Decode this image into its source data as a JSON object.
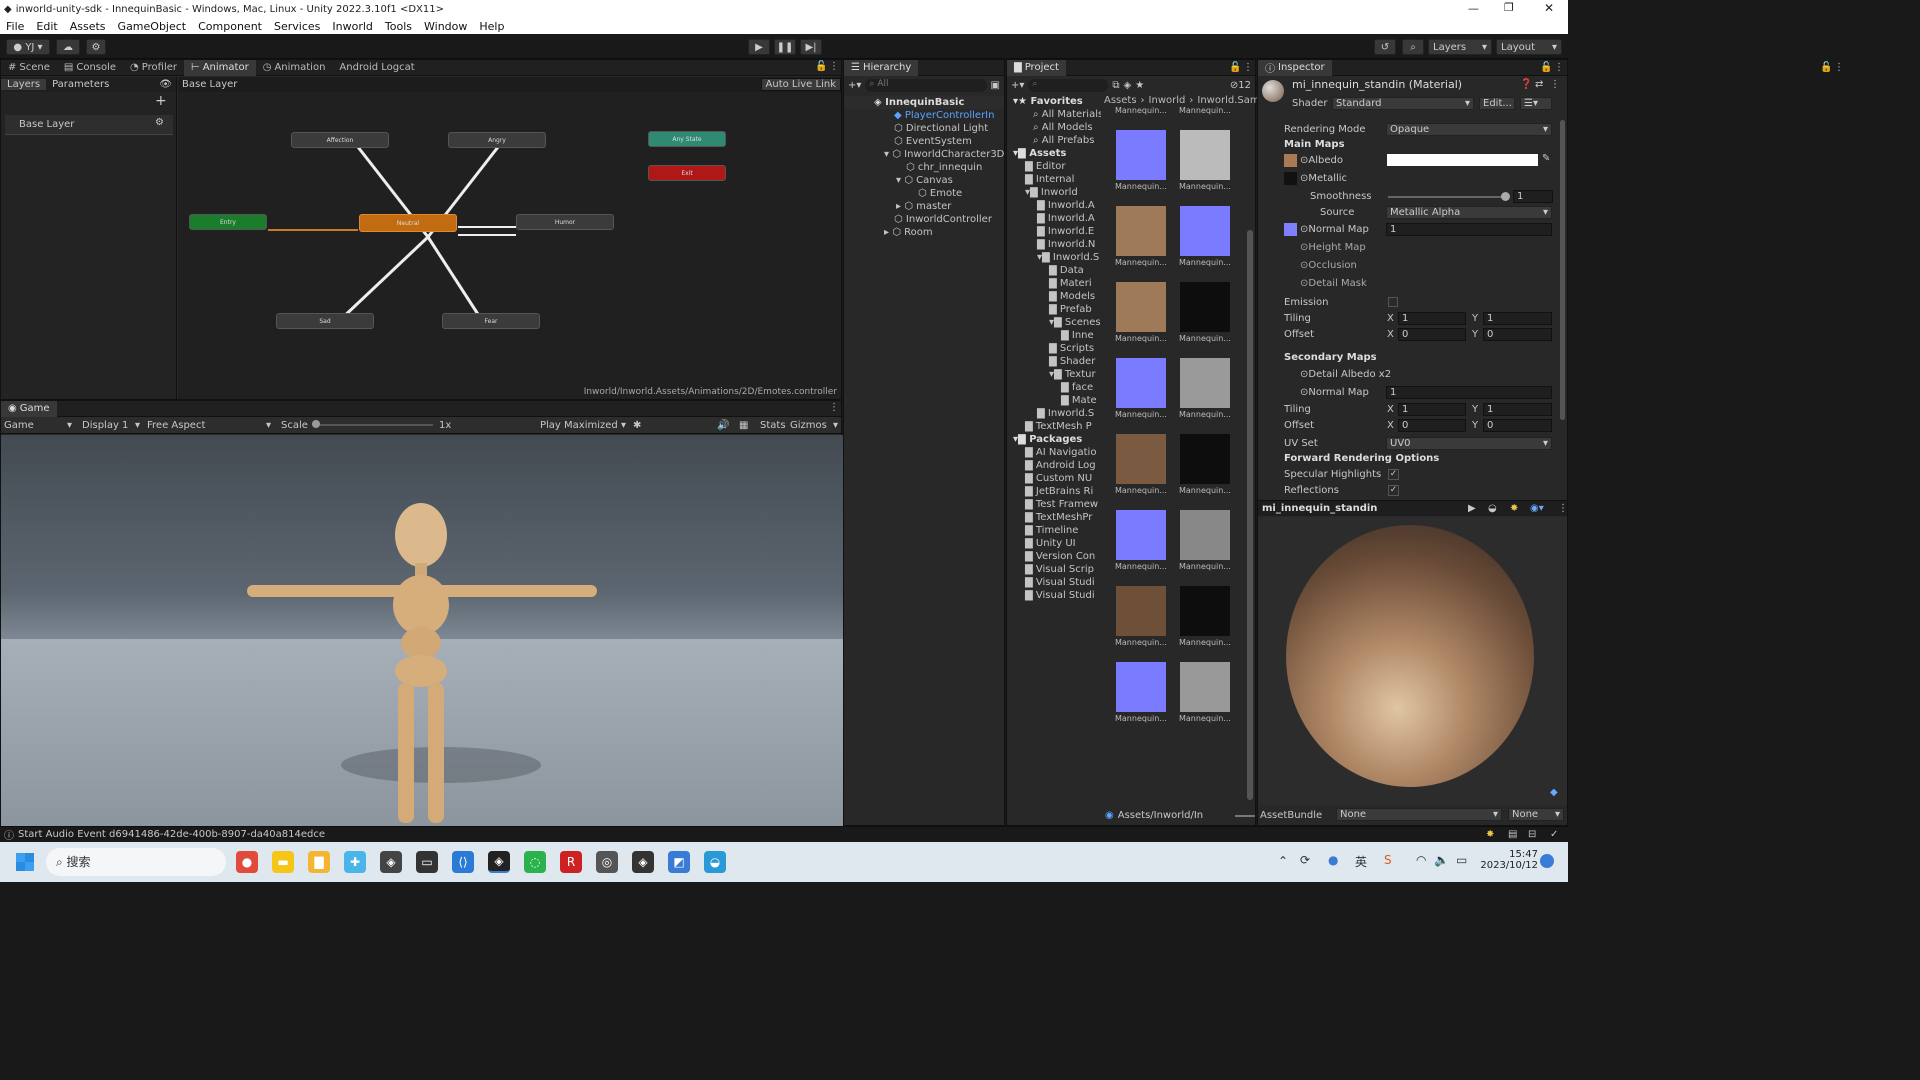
{
  "window": {
    "title": "inworld-unity-sdk - InnequinBasic - Windows, Mac, Linux - Unity 2022.3.10f1 <DX11>"
  },
  "menu": [
    "File",
    "Edit",
    "Assets",
    "GameObject",
    "Component",
    "Services",
    "Inworld",
    "Tools",
    "Window",
    "Help"
  ],
  "toolbar": {
    "account": "YJ",
    "layers": "Layers",
    "layout": "Layout"
  },
  "animator": {
    "tabs": [
      "Scene",
      "Console",
      "Profiler",
      "Animator",
      "Animation",
      "Android Logcat"
    ],
    "subtabs": [
      "Layers",
      "Parameters"
    ],
    "breadcrumb": "Base Layer",
    "auto_live_link": "Auto Live Link",
    "layer_name": "Base Layer",
    "path": "Inworld/Inworld.Assets/Animations/2D/Emotes.controller",
    "states": {
      "affection": "Affection",
      "angry": "Angry",
      "any": "Any State",
      "exit": "Exit",
      "entry": "Entry",
      "neutral": "Neutral",
      "humor": "Humor",
      "sad": "Sad",
      "fear": "Fear"
    }
  },
  "game": {
    "tab": "Game",
    "mode": "Game",
    "display": "Display 1",
    "aspect": "Free Aspect",
    "scale_label": "Scale",
    "scale_value": "1x",
    "play_mode": "Play Maximized",
    "stats": "Stats",
    "gizmos": "Gizmos"
  },
  "hierarchy": {
    "tab": "Hierarchy",
    "search_placeholder": "All",
    "items": [
      "InnequinBasic",
      "PlayerControllerIn",
      "Directional Light",
      "EventSystem",
      "InworldCharacter3D",
      "chr_innequin",
      "Canvas",
      "Emote",
      "master",
      "InworldController",
      "Room"
    ]
  },
  "project": {
    "tab": "Project",
    "count": "12",
    "breadcrumb": [
      "Assets",
      "Inworld",
      "Inworld.Sam"
    ],
    "favorites": [
      "Favorites",
      "All Materials",
      "All Models",
      "All Prefabs"
    ],
    "assets": [
      "Assets",
      "Editor",
      "Internal",
      "Inworld",
      "Inworld.A",
      "Inworld.A",
      "Inworld.E",
      "Inworld.N",
      "Inworld.S",
      "Data",
      "Materi",
      "Models",
      "Prefab",
      "Scenes",
      "Inne",
      "Scripts",
      "Shader",
      "Textur",
      "face",
      "Mate",
      "Inworld.S",
      "TextMesh P"
    ],
    "packages": [
      "Packages",
      "AI Navigatio",
      "Android Log",
      "Custom NU",
      "JetBrains Ri",
      "Test Framew",
      "TextMeshPr",
      "Timeline",
      "Unity UI",
      "Version Con",
      "Visual Scrip",
      "Visual Studi",
      "Visual Studi"
    ],
    "thumb_label": "Mannequin...",
    "bottom_path": "Assets/Inworld/In"
  },
  "inspector": {
    "tab": "Inspector",
    "material_name": "mi_innequin_standin (Material)",
    "shader_label": "Shader",
    "shader_value": "Standard",
    "edit_button": "Edit...",
    "rendering_mode_label": "Rendering Mode",
    "rendering_mode_value": "Opaque",
    "main_maps": "Main Maps",
    "albedo": "Albedo",
    "metallic": "Metallic",
    "smoothness": "Smoothness",
    "smoothness_value": "1",
    "source_label": "Source",
    "source_value": "Metallic Alpha",
    "normal_map": "Normal Map",
    "normal_value": "1",
    "height_map": "Height Map",
    "occlusion": "Occlusion",
    "detail_mask": "Detail Mask",
    "emission": "Emission",
    "tiling": "Tiling",
    "offset": "Offset",
    "x": "X",
    "y": "Y",
    "one": "1",
    "zero": "0",
    "secondary_maps": "Secondary Maps",
    "detail_albedo": "Detail Albedo x2",
    "uv_set_label": "UV Set",
    "uv_set_value": "UV0",
    "forward_options": "Forward Rendering Options",
    "specular": "Specular Highlights",
    "reflections": "Reflections",
    "preview_name": "mi_innequin_standin",
    "assetbundle_label": "AssetBundle",
    "assetbundle_value": "None",
    "assetbundle_variant": "None"
  },
  "status": {
    "message": "Start Audio Event d6941486-42de-400b-8907-da40a814edce"
  },
  "taskbar": {
    "search": "搜索",
    "ime": "英",
    "time": "15:47",
    "date": "2023/10/12"
  }
}
